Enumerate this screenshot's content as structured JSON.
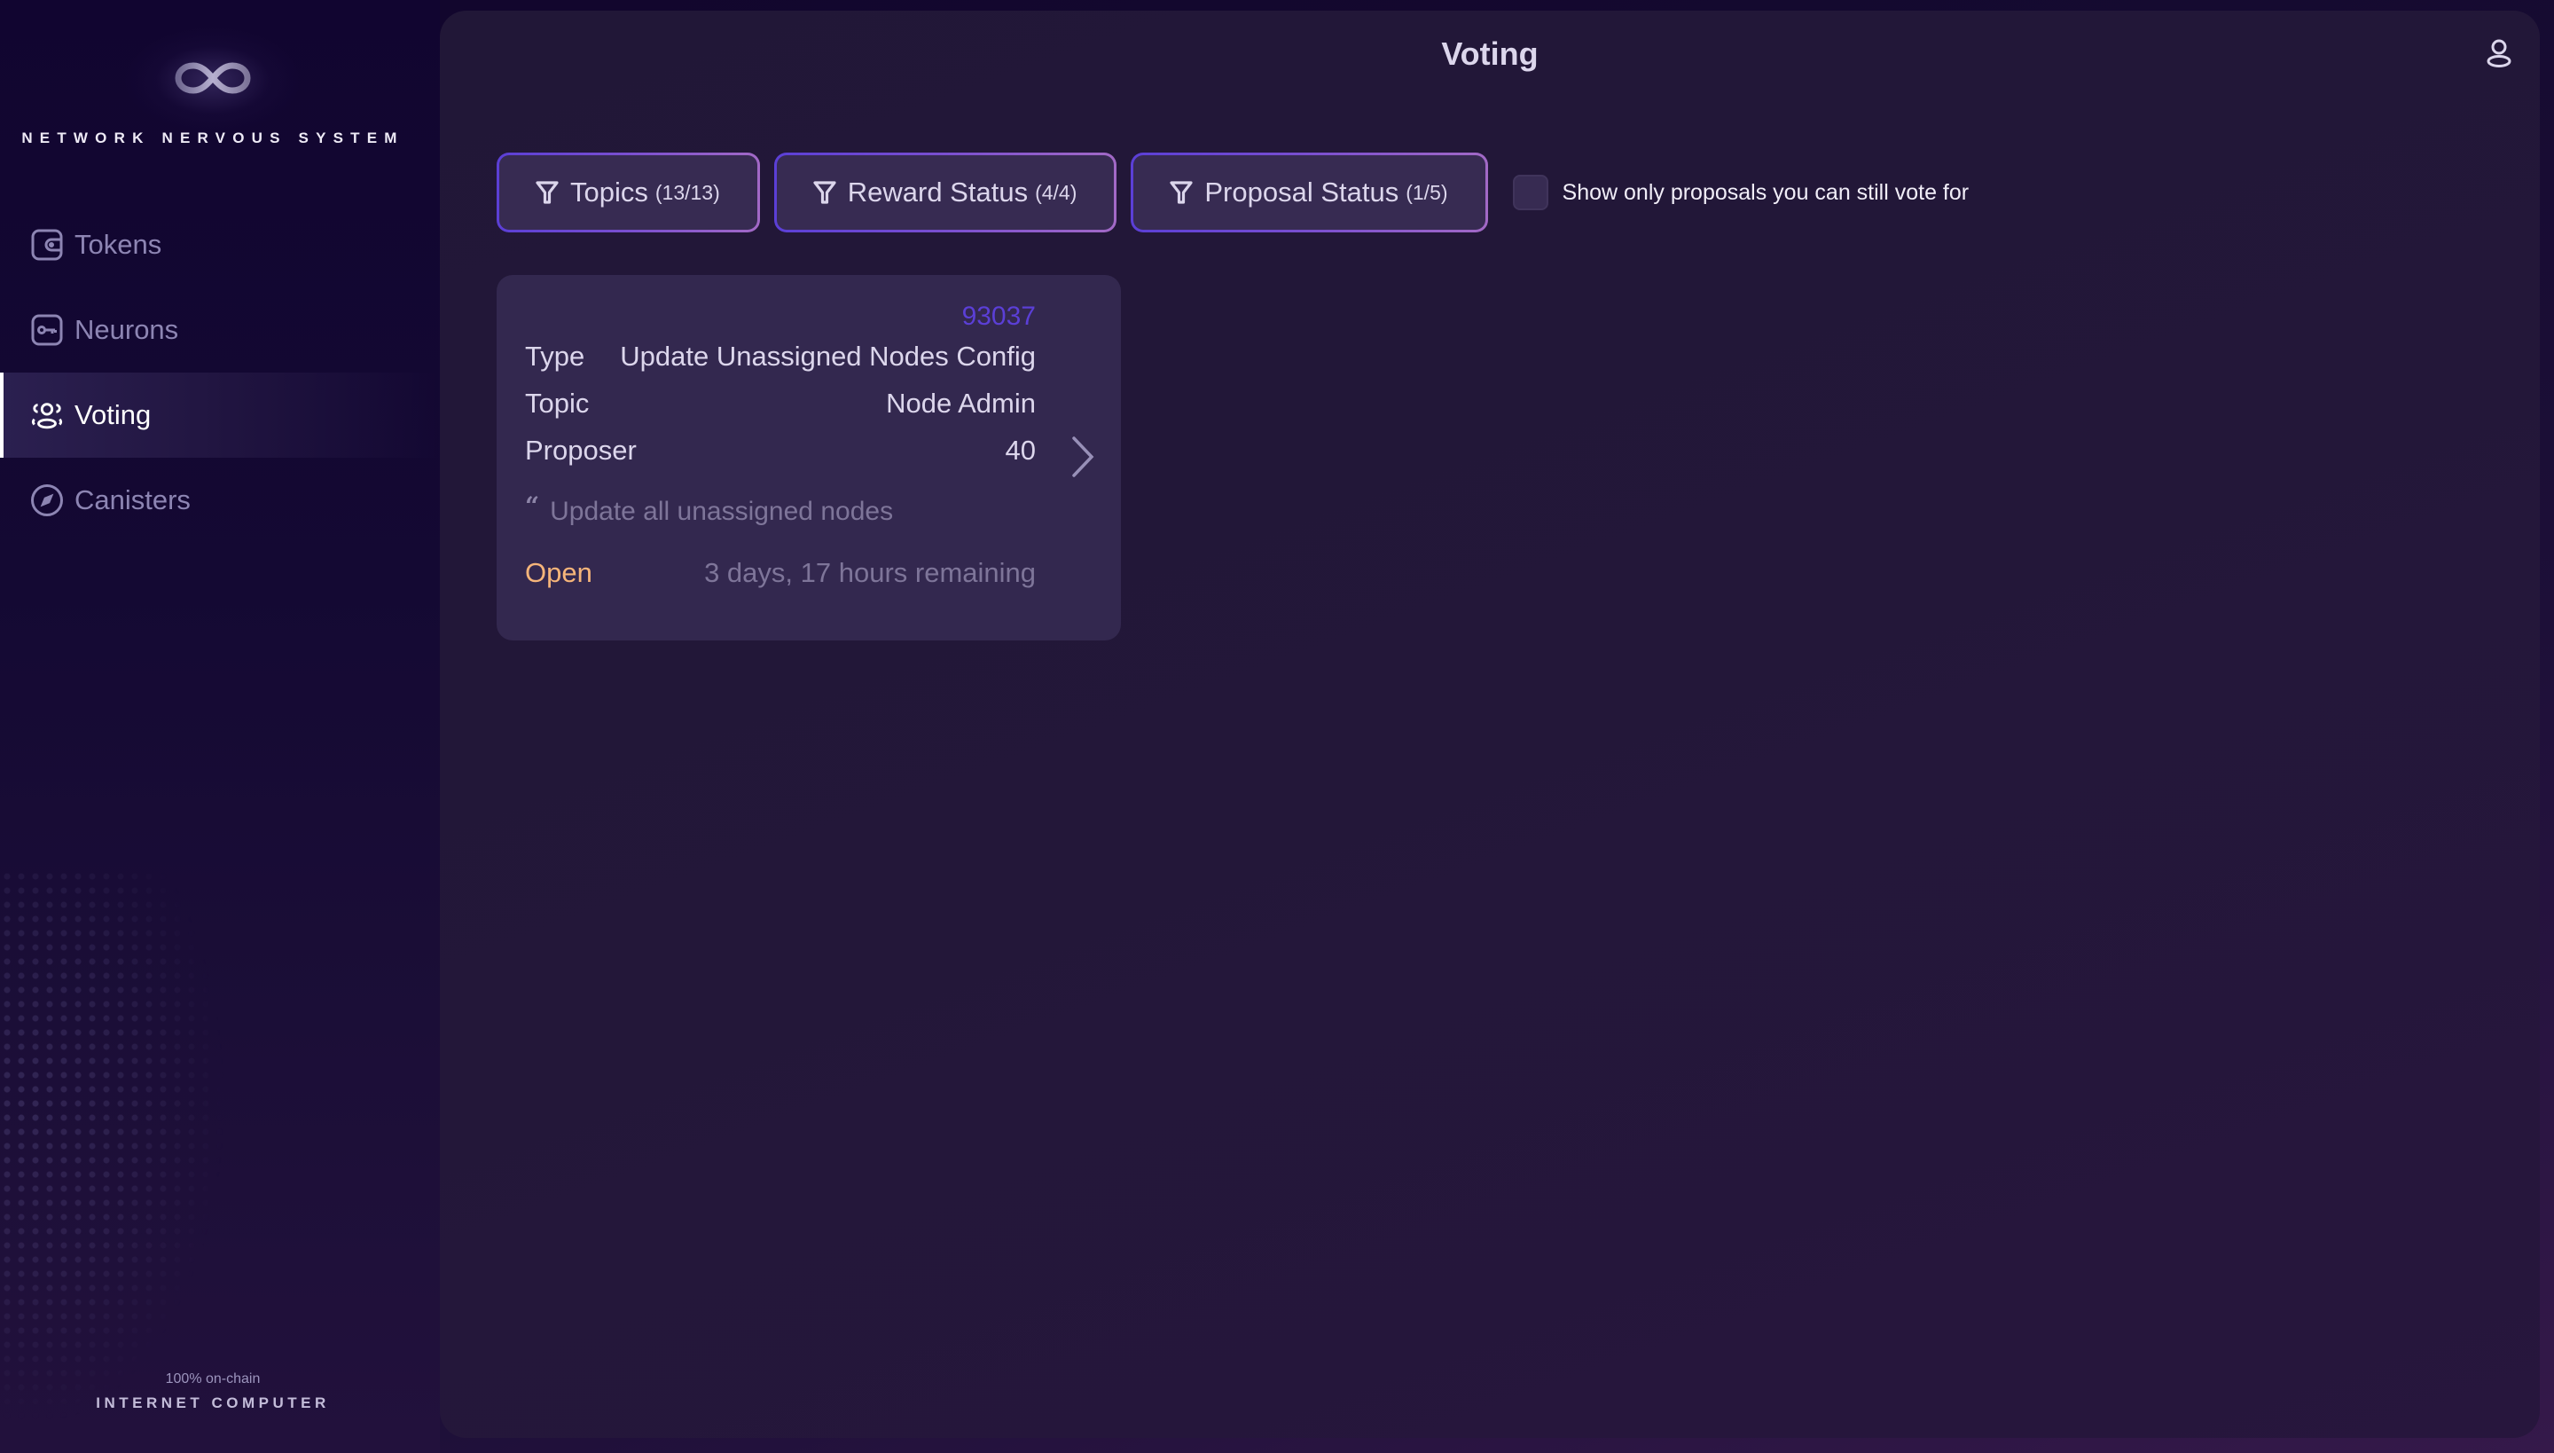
{
  "app": {
    "name": "NETWORK NERVOUS SYSTEM",
    "footer_small": "100% on-chain",
    "footer_big": "INTERNET COMPUTER"
  },
  "sidebar": {
    "items": [
      {
        "label": "Tokens",
        "icon": "wallet-icon",
        "active": false
      },
      {
        "label": "Neurons",
        "icon": "key-icon",
        "active": false
      },
      {
        "label": "Voting",
        "icon": "users-icon",
        "active": true
      },
      {
        "label": "Canisters",
        "icon": "compass-icon",
        "active": false
      }
    ]
  },
  "header": {
    "title": "Voting",
    "account_icon": "user-icon"
  },
  "filters": {
    "buttons": [
      {
        "label": "Topics",
        "count": "(13/13)",
        "icon": "filter-icon"
      },
      {
        "label": "Reward Status",
        "count": "(4/4)",
        "icon": "filter-icon"
      },
      {
        "label": "Proposal Status",
        "count": "(1/5)",
        "icon": "filter-icon"
      }
    ],
    "checkbox_label": "Show only proposals you can still vote for",
    "checkbox_checked": false
  },
  "proposals": [
    {
      "id": "93037",
      "type_label": "Type",
      "type": "Update Unassigned Nodes Config",
      "topic_label": "Topic",
      "topic": "Node Admin",
      "proposer_label": "Proposer",
      "proposer": "40",
      "quote_mark": "“",
      "summary": "Update all unassigned nodes",
      "status": "Open",
      "remaining": "3 days, 17 hours remaining"
    }
  ],
  "colors": {
    "accent": "#5b3fd6",
    "status_open": "#f6b57a",
    "card_bg": "#33284f",
    "panel_bg": "#221738"
  }
}
